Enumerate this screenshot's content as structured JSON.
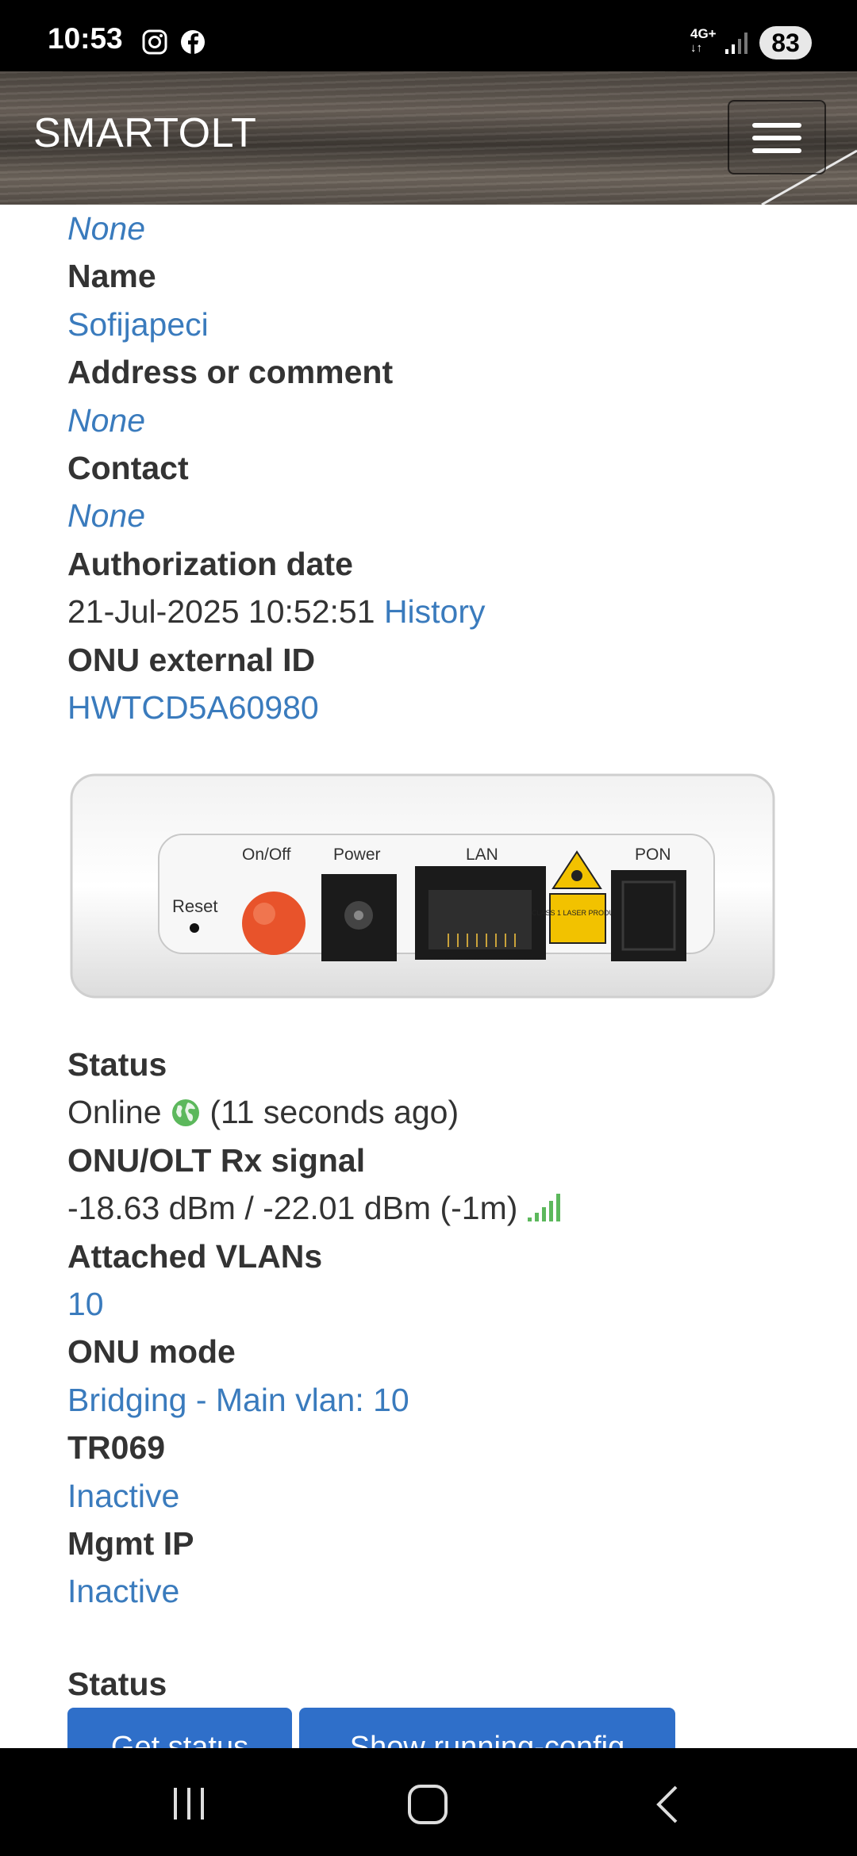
{
  "statusbar": {
    "time": "10:53",
    "network": "4G+",
    "battery": "83"
  },
  "navbar": {
    "brand": "SMARTOLT"
  },
  "details": {
    "top_value": "None",
    "name_label": "Name",
    "name_value": "Sofijapeci",
    "address_label": "Address or comment",
    "address_value": "None",
    "contact_label": "Contact",
    "contact_value": "None",
    "auth_label": "Authorization date",
    "auth_value": "21-Jul-2025 10:52:51",
    "auth_history": "History",
    "extid_label": "ONU external ID",
    "extid_value": "HWTCD5A60980"
  },
  "device": {
    "reset": "Reset",
    "onoff": "On/Off",
    "power": "Power",
    "lan": "LAN",
    "pon": "PON",
    "laser_label": "CLASS 1 LASER PRODUCT"
  },
  "status": {
    "status_label": "Status",
    "status_value": "Online",
    "status_ago": "(11 seconds ago)",
    "signal_label": "ONU/OLT Rx signal",
    "signal_value": "-18.63 dBm / -22.01 dBm (-1m)",
    "vlans_label": "Attached VLANs",
    "vlans_value": "10",
    "mode_label": "ONU mode",
    "mode_value": "Bridging - Main vlan: 10",
    "tr069_label": "TR069",
    "tr069_value": "Inactive",
    "mgmt_label": "Mgmt IP",
    "mgmt_value": "Inactive"
  },
  "actions": {
    "section_label": "Status",
    "get_status": "Get status",
    "show_config": "Show running-config"
  },
  "colors": {
    "link": "#3a7bbd",
    "button": "#2f6fc9",
    "online": "#5cb85c"
  }
}
